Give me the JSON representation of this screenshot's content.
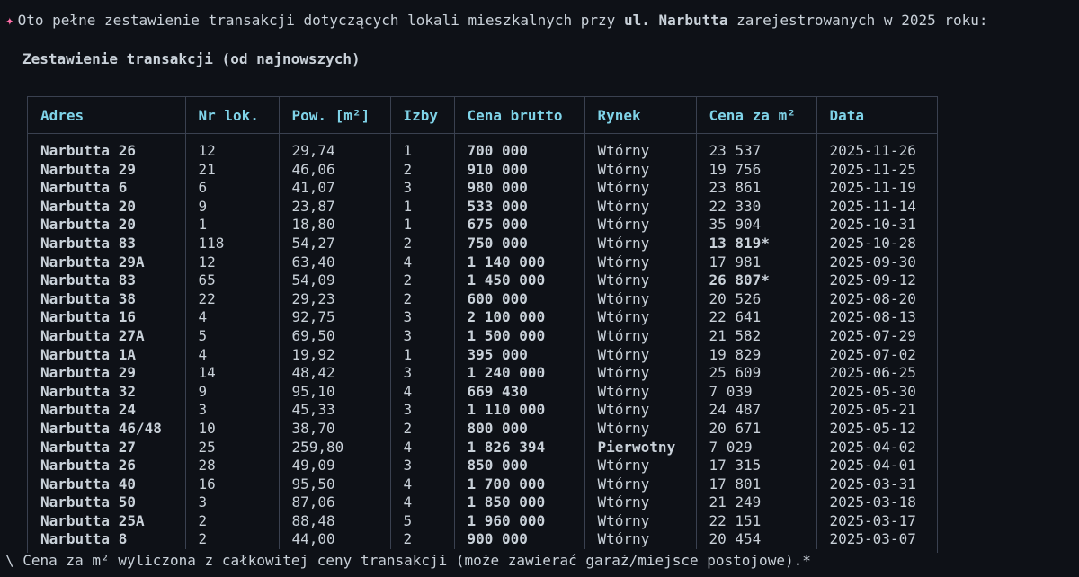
{
  "intro": {
    "prefix": "Oto pełne zestawienie transakcji dotyczących lokali mieszkalnych przy ",
    "street": "ul. Narbutta",
    "suffix": " zarejestrowanych w 2025 roku:",
    "sparkle_icon": "sparkle-icon"
  },
  "section_title": "Zestawienie transakcji (od najnowszych)",
  "columns": [
    "Adres",
    "Nr lok.",
    "Pow. [m²]",
    "Izby",
    "Cena brutto",
    "Rynek",
    "Cena za m²",
    "Data"
  ],
  "rows": [
    [
      "Narbutta 26",
      "12",
      "29,74",
      "1",
      "700 000",
      "Wtórny",
      "23 537",
      "2025-11-26"
    ],
    [
      "Narbutta 29",
      "21",
      "46,06",
      "2",
      "910 000",
      "Wtórny",
      "19 756",
      "2025-11-25"
    ],
    [
      "Narbutta 6",
      "6",
      "41,07",
      "3",
      "980 000",
      "Wtórny",
      "23 861",
      "2025-11-19"
    ],
    [
      "Narbutta 20",
      "9",
      "23,87",
      "1",
      "533 000",
      "Wtórny",
      "22 330",
      "2025-11-14"
    ],
    [
      "Narbutta 20",
      "1",
      "18,80",
      "1",
      "675 000",
      "Wtórny",
      "35 904",
      "2025-10-31"
    ],
    [
      "Narbutta 83",
      "118",
      "54,27",
      "2",
      "750 000",
      "Wtórny",
      "13 819*",
      "2025-10-28"
    ],
    [
      "Narbutta 29A",
      "12",
      "63,40",
      "4",
      "1 140 000",
      "Wtórny",
      "17 981",
      "2025-09-30"
    ],
    [
      "Narbutta 83",
      "65",
      "54,09",
      "2",
      "1 450 000",
      "Wtórny",
      "26 807*",
      "2025-09-12"
    ],
    [
      "Narbutta 38",
      "22",
      "29,23",
      "2",
      "600 000",
      "Wtórny",
      "20 526",
      "2025-08-20"
    ],
    [
      "Narbutta 16",
      "4",
      "92,75",
      "3",
      "2 100 000",
      "Wtórny",
      "22 641",
      "2025-08-13"
    ],
    [
      "Narbutta 27A",
      "5",
      "69,50",
      "3",
      "1 500 000",
      "Wtórny",
      "21 582",
      "2025-07-29"
    ],
    [
      "Narbutta 1A",
      "4",
      "19,92",
      "1",
      "395 000",
      "Wtórny",
      "19 829",
      "2025-07-02"
    ],
    [
      "Narbutta 29",
      "14",
      "48,42",
      "3",
      "1 240 000",
      "Wtórny",
      "25 609",
      "2025-06-25"
    ],
    [
      "Narbutta 32",
      "9",
      "95,10",
      "4",
      "669 430",
      "Wtórny",
      "7 039",
      "2025-05-30"
    ],
    [
      "Narbutta 24",
      "3",
      "45,33",
      "3",
      "1 110 000",
      "Wtórny",
      "24 487",
      "2025-05-21"
    ],
    [
      "Narbutta 46/48",
      "10",
      "38,70",
      "2",
      "800 000",
      "Wtórny",
      "20 671",
      "2025-05-12"
    ],
    [
      "Narbutta 27",
      "25",
      "259,80",
      "4",
      "1 826 394",
      "Pierwotny",
      "7 029",
      "2025-04-02"
    ],
    [
      "Narbutta 26",
      "28",
      "49,09",
      "3",
      "850 000",
      "Wtórny",
      "17 315",
      "2025-04-01"
    ],
    [
      "Narbutta 40",
      "16",
      "95,50",
      "4",
      "1 700 000",
      "Wtórny",
      "17 801",
      "2025-03-31"
    ],
    [
      "Narbutta 50",
      "3",
      "87,06",
      "4",
      "1 850 000",
      "Wtórny",
      "21 249",
      "2025-03-18"
    ],
    [
      "Narbutta 25A",
      "2",
      "88,48",
      "5",
      "1 960 000",
      "Wtórny",
      "22 151",
      "2025-03-17"
    ],
    [
      "Narbutta 8",
      "2",
      "44,00",
      "2",
      "900 000",
      "Wtórny",
      "20 454",
      "2025-03-07"
    ]
  ],
  "footnote": "\\ Cena za m² wyliczona z całkowitej ceny transakcji (może zawierać garaż/miejsce postojowe).*",
  "colors": {
    "header": "#7fd3e8",
    "text": "#c9d1d9",
    "background": "#0e1117",
    "border": "#3a4150",
    "sparkle": "#ff6fa8"
  }
}
